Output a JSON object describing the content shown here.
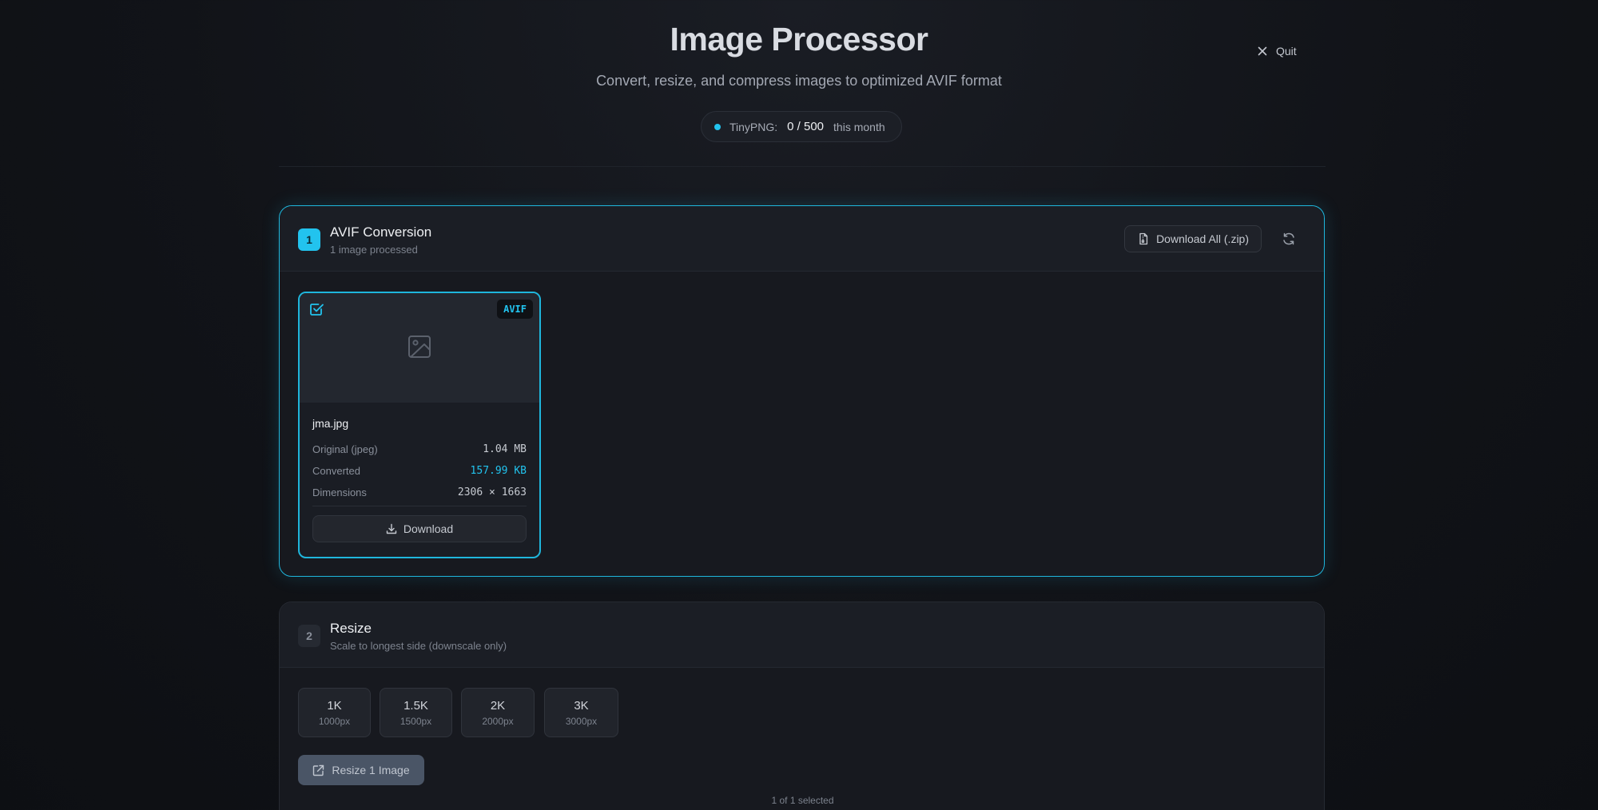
{
  "header": {
    "title": "Image Processor",
    "subtitle": "Convert, resize, and compress images to optimized AVIF format",
    "quit_label": "Quit",
    "quota": {
      "label": "TinyPNG:",
      "value": "0 / 500",
      "suffix": "this month",
      "status_color": "#22c3ee"
    }
  },
  "conversion": {
    "step": "1",
    "title": "AVIF Conversion",
    "subtitle": "1 image processed",
    "download_all_label": "Download All (.zip)",
    "image": {
      "badge": "AVIF",
      "filename": "jma.jpg",
      "selected": true,
      "rows": [
        {
          "label": "Original (jpeg)",
          "value": "1.04 MB"
        },
        {
          "label": "Converted",
          "value": "157.99 KB"
        },
        {
          "label": "Dimensions",
          "value": "2306 × 1663"
        }
      ],
      "download_label": "Download"
    }
  },
  "resize": {
    "step": "2",
    "title": "Resize",
    "subtitle": "Scale to longest side (downscale only)",
    "presets": [
      {
        "label": "1K",
        "sub": "1000px"
      },
      {
        "label": "1.5K",
        "sub": "1500px"
      },
      {
        "label": "2K",
        "sub": "2000px"
      },
      {
        "label": "3K",
        "sub": "3000px"
      }
    ],
    "action_label": "Resize 1 Image",
    "selection_text": "1 of 1 selected"
  },
  "colors": {
    "accent": "#22c3ee",
    "background": "#111318"
  }
}
